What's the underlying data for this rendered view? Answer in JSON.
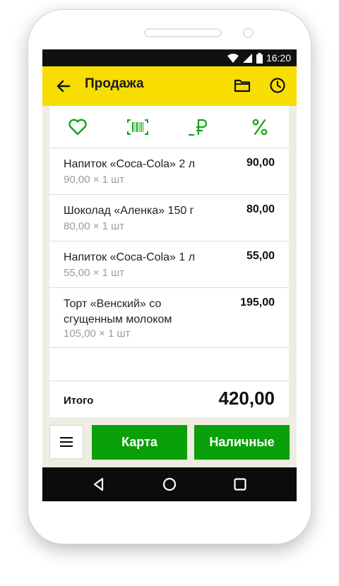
{
  "status_bar": {
    "time": "16:20"
  },
  "app_bar": {
    "title": "Продажа"
  },
  "toolbar": {
    "icons": [
      "heart-icon",
      "barcode-icon",
      "ruble-icon",
      "percent-icon"
    ],
    "accent_color": "#12a312"
  },
  "items": [
    {
      "name": "Напиток «Coca-Cola» 2 л",
      "detail": "90,00 × 1 шт",
      "price": "90,00"
    },
    {
      "name": "Шоколад «Аленка» 150 г",
      "detail": "80,00 × 1 шт",
      "price": "80,00"
    },
    {
      "name": "Напиток «Coca-Cola» 1 л",
      "detail": "55,00 × 1 шт",
      "price": "55,00"
    },
    {
      "name": "Торт «Венский» со сгущенным молоком",
      "detail": "105,00 × 1 шт",
      "price": "195,00"
    }
  ],
  "total": {
    "label": "Итого",
    "value": "420,00"
  },
  "actions": {
    "card_label": "Карта",
    "cash_label": "Наличные"
  },
  "colors": {
    "app_bar": "#f8de00",
    "button": "#0aa00a",
    "background": "#efece2"
  }
}
